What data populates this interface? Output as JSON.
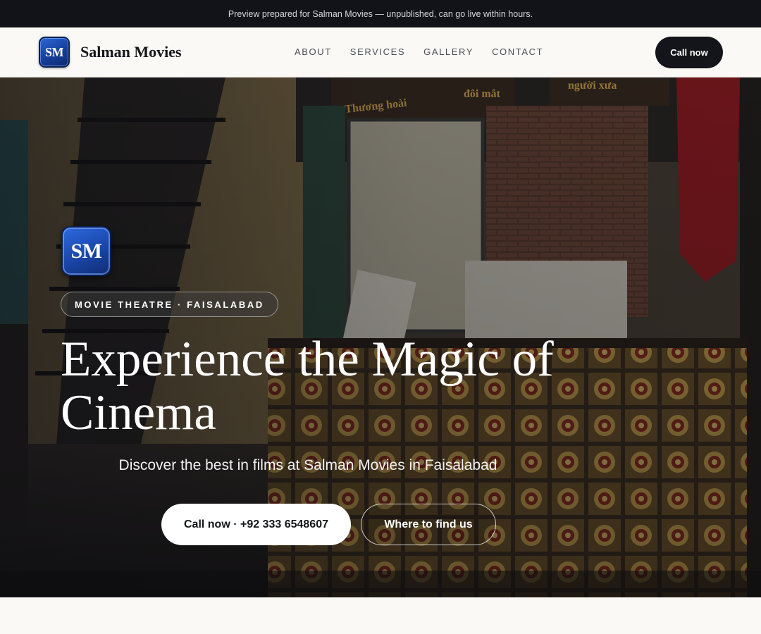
{
  "preview_banner": "Preview prepared for Salman Movies — unpublished, can go live within hours.",
  "brand": {
    "logo_text": "SM",
    "name": "Salman Movies",
    "logo_color": "#1a46a8"
  },
  "nav": {
    "links": [
      "ABOUT",
      "SERVICES",
      "GALLERY",
      "CONTACT"
    ],
    "cta": "Call now"
  },
  "hero": {
    "logo_text": "SM",
    "badge": "MOVIE THEATRE · FAISALABAD",
    "title": "Experience the Magic of Cinema",
    "subtitle": "Discover the best in films at Salman Movies in Faisalabad",
    "primary_button": "Call now · +92 333 6548607",
    "secondary_button": "Where to find us",
    "background_sign_texts": [
      "Thương hoài",
      "đôi mắt",
      "người xưa"
    ]
  },
  "colors": {
    "dark": "#111319",
    "page_bg": "#faf9f6",
    "accent_red": "#b3141c"
  }
}
